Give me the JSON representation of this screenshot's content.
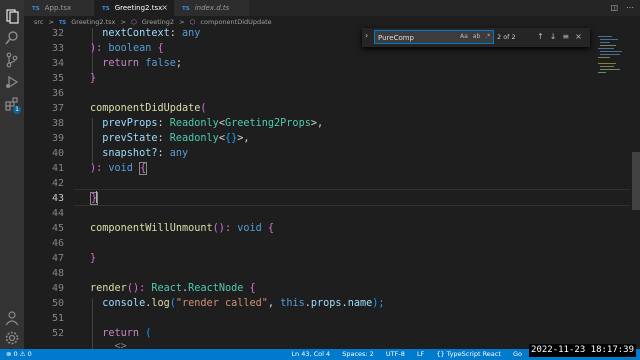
{
  "tabs": [
    {
      "lang": "TS",
      "name": "App.tsx"
    },
    {
      "lang": "TS",
      "name": "Greeting2.tsx",
      "close": "×"
    },
    {
      "lang": "TS",
      "name": "index.d.ts"
    }
  ],
  "breadcrumb": {
    "folder": "src",
    "sep": ">",
    "ts": "TS",
    "file": "Greeting2.tsx",
    "cls": "Greeting2",
    "method": "componentDidUpdate"
  },
  "find": {
    "query": "PureComp",
    "match_case": "Aa",
    "whole_word": "ab",
    "regex": ".*",
    "count": "2 of 2"
  },
  "gutter": [
    "32",
    "33",
    "34",
    "35",
    "36",
    "37",
    "38",
    "39",
    "40",
    "41",
    "42",
    "43",
    "44",
    "45",
    "46",
    "47",
    "48",
    "49",
    "50",
    "51",
    "52"
  ],
  "code": {
    "l32": {
      "a": "  nextContext",
      "b": ": ",
      "c": "any"
    },
    "l33": {
      "a": "): ",
      "b": "boolean",
      "c": " {"
    },
    "l34": {
      "a": "  return",
      "b": " ",
      "c": "false",
      "d": ";"
    },
    "l35": {
      "a": "}"
    },
    "l37": {
      "a": "componentDidUpdate",
      "b": "("
    },
    "l38": {
      "a": "  prevProps",
      "b": ": ",
      "c": "Readonly",
      "d": "<",
      "e": "Greeting2Props",
      "f": ">,"
    },
    "l39": {
      "a": "  prevState",
      "b": ": ",
      "c": "Readonly",
      "d": "<",
      "e": "{}",
      "f": ">,"
    },
    "l40": {
      "a": "  snapshot?",
      "b": ": ",
      "c": "any"
    },
    "l41": {
      "a": "): ",
      "b": "void",
      "c": " ",
      "d": "{"
    },
    "l43": {
      "a": "}"
    },
    "l45": {
      "a": "componentWillUnmount",
      "b": "(): ",
      "c": "void",
      "d": " {"
    },
    "l47": {
      "a": "}"
    },
    "l49": {
      "a": "render",
      "b": "(): ",
      "c": "React",
      "d": ".",
      "e": "ReactNode",
      "f": " {"
    },
    "l50": {
      "a": "  console",
      "b": ".",
      "c": "log",
      "d": "(",
      "e": "\"render called\"",
      "f": ", ",
      "g": "this",
      "h": ".",
      "i": "props",
      "j": ".",
      "k": "name",
      "l": ");"
    },
    "l52": {
      "a": "  return",
      "b": " ("
    },
    "l53": {
      "a": "    <>"
    }
  },
  "status": {
    "errors": "⊗ 0",
    "warnings": "⚠ 0",
    "position": "Ln 43, Col 4",
    "spaces": "Spaces: 2",
    "encoding": "UTF-8",
    "eol": "LF",
    "language": "{} TypeScript React",
    "extra": "Go",
    "timestamp": "2022-11-23  18:17:39"
  },
  "activity_badge": "1",
  "colors": {
    "accent": "#007acc",
    "editor_bg": "#1e1e1e",
    "keyword": "#569cd6",
    "type": "#4ec9b0",
    "function": "#dcdcaa"
  }
}
